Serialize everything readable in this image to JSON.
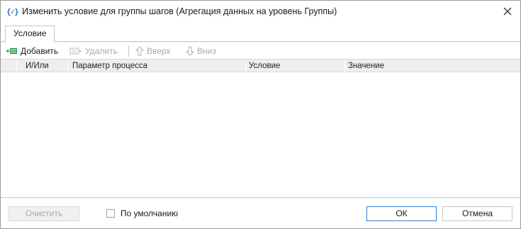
{
  "window": {
    "title": "Изменить условие для группы шагов (Агрегация данных на уровень Группы)",
    "icon": "curly-braces-check-icon"
  },
  "tabs": [
    {
      "label": "Условие",
      "active": true
    }
  ],
  "toolbar": {
    "add_label": "Добавить",
    "delete_label": "Удалить",
    "up_label": "Вверх",
    "down_label": "Вниз"
  },
  "grid": {
    "columns": [
      "И/Или",
      "Параметр процесса",
      "Условие",
      "Значение"
    ],
    "rows": []
  },
  "footer": {
    "clear_label": "Очистить",
    "default_label": "По умолчанию",
    "default_checked": false,
    "ok_label": "ОК",
    "cancel_label": "Отмена"
  },
  "colors": {
    "accent": "#2f7fd1",
    "add_icon": "#2e9e4a",
    "disabled": "#a8a8a8"
  }
}
